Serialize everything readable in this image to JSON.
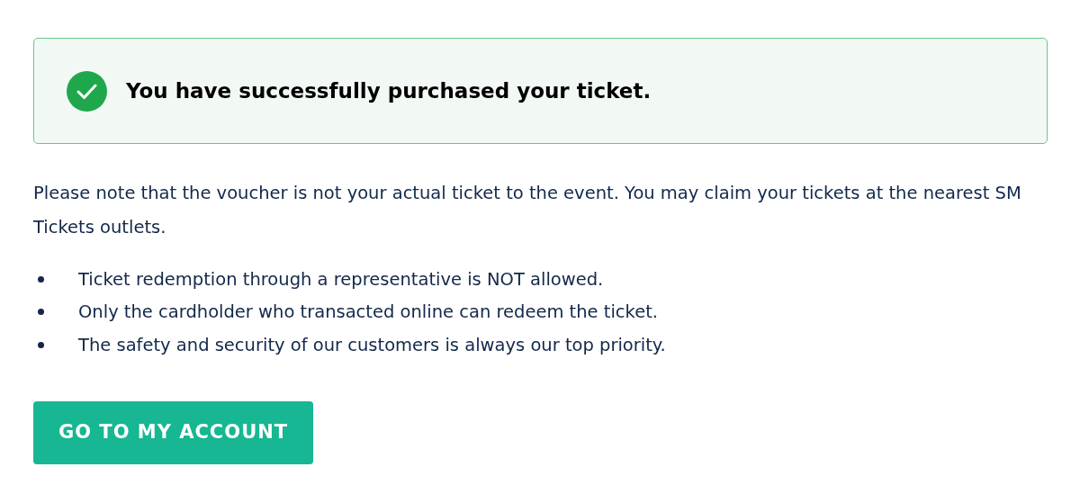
{
  "alert": {
    "message": "You have successfully purchased your ticket."
  },
  "note": "Please note that the voucher is not your actual ticket to the event. You may claim your tickets at the nearest SM Tickets outlets.",
  "bullets": [
    "Ticket redemption through a representative is NOT allowed.",
    "Only the cardholder who transacted online can redeem the ticket.",
    "The safety and security of our customers is always our top priority."
  ],
  "button": {
    "label": "GO TO MY ACCOUNT"
  }
}
